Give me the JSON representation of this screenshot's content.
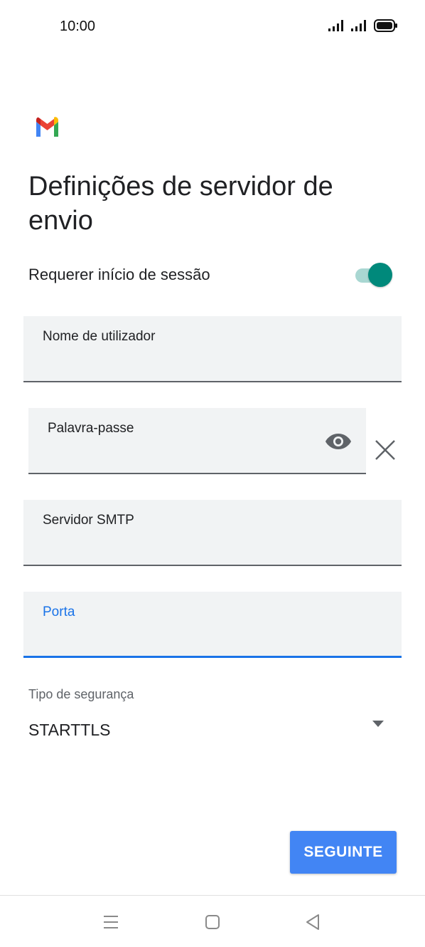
{
  "status_bar": {
    "time": "10:00"
  },
  "page": {
    "title": "Definições de servidor de envio"
  },
  "require_sign_in": {
    "label": "Requerer início de sessão",
    "enabled": true
  },
  "fields": {
    "username": {
      "label": "Nome de utilizador",
      "value": ""
    },
    "password": {
      "label": "Palavra-passe",
      "value": ""
    },
    "smtp_server": {
      "label": "Servidor SMTP",
      "value": ""
    },
    "port": {
      "label": "Porta",
      "value": ""
    }
  },
  "security": {
    "label": "Tipo de segurança",
    "selected": "STARTTLS"
  },
  "actions": {
    "next_label": "SEGUINTE"
  },
  "colors": {
    "accent": "#1a73e8",
    "button": "#4285f4",
    "toggle_on": "#00897b",
    "field_bg": "#f1f3f4"
  },
  "icons": {
    "logo": "gmail-logo",
    "show_password": "eye-icon",
    "clear": "close-icon",
    "dropdown": "caret-down-icon",
    "nav_menu": "menu-icon",
    "nav_home": "home-icon",
    "nav_back": "back-icon"
  }
}
